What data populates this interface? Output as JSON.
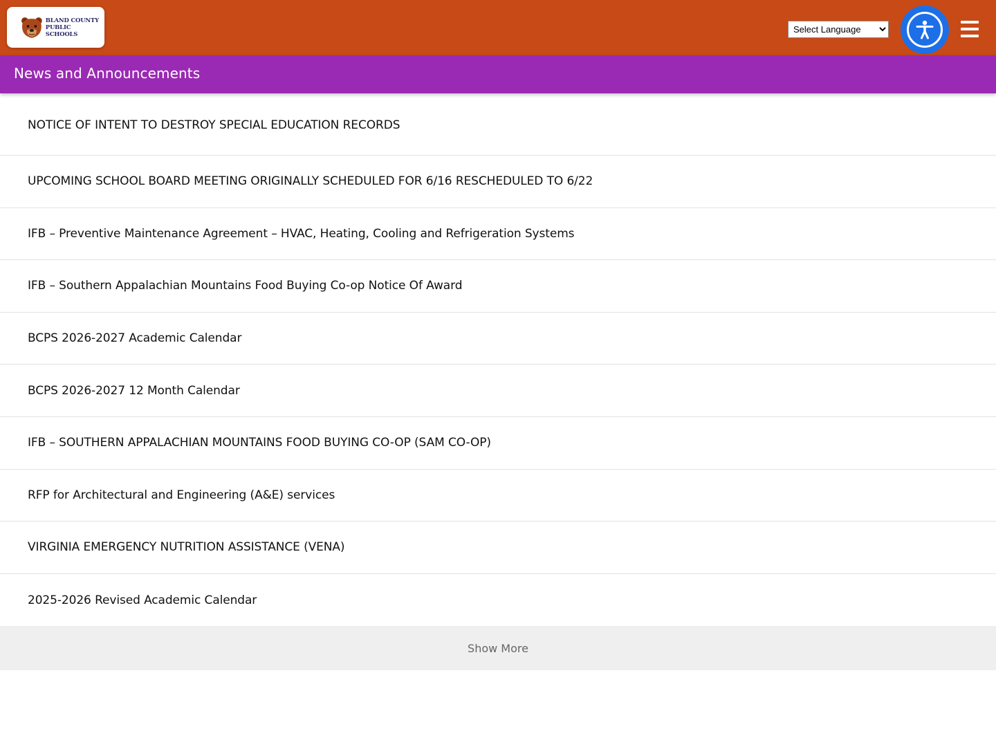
{
  "header": {
    "logo_line1": "BLAND COUNTY",
    "logo_line2": "PUBLIC SCHOOLS",
    "language_select": {
      "selected": "Select Language",
      "options": [
        "Select Language"
      ]
    },
    "accessibility_icon": "accessibility-person-icon",
    "menu_icon": "hamburger-menu-icon",
    "colors": {
      "header_bg": "#c84a17",
      "section_bg": "#9a2ab3",
      "accessibility_bg": "#1d6fe8"
    }
  },
  "section": {
    "title": "News and Announcements"
  },
  "news": {
    "items": [
      "NOTICE OF INTENT TO DESTROY SPECIAL EDUCATION RECORDS",
      "UPCOMING SCHOOL BOARD MEETING ORIGINALLY SCHEDULED FOR 6/16 RESCHEDULED TO 6/22",
      "IFB – Preventive Maintenance Agreement – HVAC, Heating, Cooling and Refrigeration Systems",
      "IFB – Southern Appalachian Mountains Food Buying Co-op Notice Of Award",
      "BCPS 2026-2027 Academic Calendar",
      "BCPS 2026-2027 12 Month Calendar",
      "IFB – SOUTHERN APPALACHIAN MOUNTAINS FOOD BUYING CO-OP (SAM CO-OP)",
      "RFP for Architectural and Engineering (A&E) services",
      "VIRGINIA EMERGENCY NUTRITION ASSISTANCE (VENA)",
      "2025-2026 Revised Academic Calendar"
    ],
    "show_more_label": "Show More"
  }
}
